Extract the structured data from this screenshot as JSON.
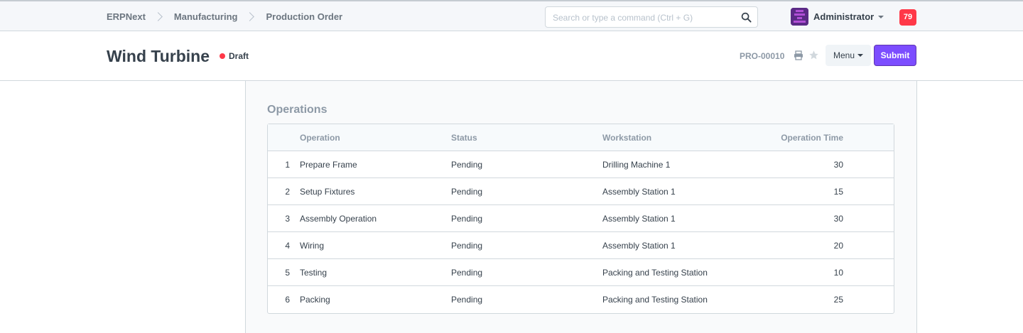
{
  "navbar": {
    "breadcrumbs": [
      "ERPNext",
      "Manufacturing",
      "Production Order"
    ],
    "search_placeholder": "Search or type a command (Ctrl + G)",
    "user_name": "Administrator",
    "notification_count": "79"
  },
  "page": {
    "title": "Wind Turbine",
    "status": "Draft",
    "doc_name": "PRO-00010",
    "menu_label": "Menu",
    "submit_label": "Submit"
  },
  "operations": {
    "section_title": "Operations",
    "columns": {
      "operation": "Operation",
      "status": "Status",
      "workstation": "Workstation",
      "time": "Operation Time"
    },
    "rows": [
      {
        "idx": "1",
        "operation": "Prepare Frame",
        "status": "Pending",
        "workstation": "Drilling Machine 1",
        "time": "30"
      },
      {
        "idx": "2",
        "operation": "Setup Fixtures",
        "status": "Pending",
        "workstation": "Assembly Station 1",
        "time": "15"
      },
      {
        "idx": "3",
        "operation": "Assembly Operation",
        "status": "Pending",
        "workstation": "Assembly Station 1",
        "time": "30"
      },
      {
        "idx": "4",
        "operation": "Wiring",
        "status": "Pending",
        "workstation": "Assembly Station 1",
        "time": "20"
      },
      {
        "idx": "5",
        "operation": "Testing",
        "status": "Pending",
        "workstation": "Packing and Testing Station",
        "time": "10"
      },
      {
        "idx": "6",
        "operation": "Packing",
        "status": "Pending",
        "workstation": "Packing and Testing Station",
        "time": "25"
      }
    ]
  },
  "colors": {
    "accent": "#7c4dff",
    "draft_indicator": "#ff3848",
    "notification_badge": "#ff3848"
  },
  "icons": [
    "search-icon",
    "chevron-right-icon",
    "print-icon",
    "star-icon",
    "chevron-down-icon"
  ]
}
